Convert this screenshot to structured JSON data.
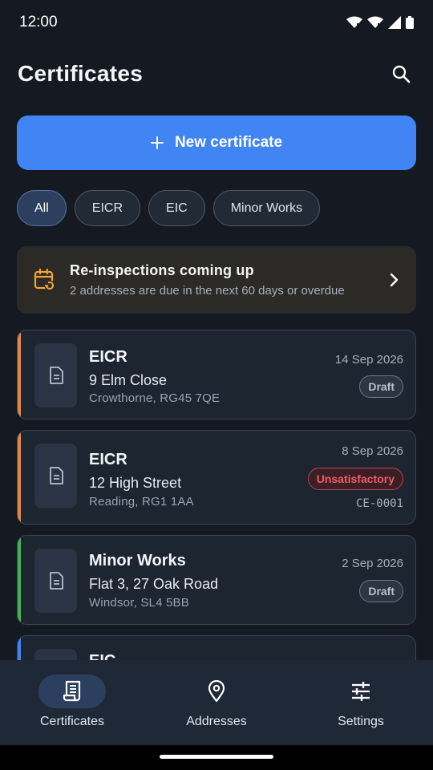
{
  "status_bar": {
    "time": "12:00"
  },
  "header": {
    "title": "Certificates"
  },
  "new_certificate": {
    "label": "New certificate"
  },
  "filters": [
    {
      "label": "All",
      "active": true
    },
    {
      "label": "EICR",
      "active": false
    },
    {
      "label": "EIC",
      "active": false
    },
    {
      "label": "Minor Works",
      "active": false
    }
  ],
  "reinspection": {
    "title": "Re-inspections coming up",
    "subtitle": "2 addresses are due in the next 60 days or overdue"
  },
  "certificates": [
    {
      "type": "EICR",
      "address": "9 Elm Close",
      "town": "Crowthorne, RG45 7QE",
      "date": "14 Sep 2026",
      "status": "Draft",
      "reference": ""
    },
    {
      "type": "EICR",
      "address": "12 High Street",
      "town": "Reading, RG1 1AA",
      "date": "8 Sep 2026",
      "status": "Unsatisfactory",
      "reference": "CE-0001"
    },
    {
      "type": "Minor Works",
      "address": "Flat 3, 27 Oak Road",
      "town": "Windsor, SL4 5BB",
      "date": "2 Sep 2026",
      "status": "Draft",
      "reference": ""
    },
    {
      "type": "EIC",
      "address": "",
      "town": "",
      "date": "",
      "status": "",
      "reference": ""
    }
  ],
  "bottom_nav": [
    {
      "label": "Certificates",
      "icon": "receipt-icon",
      "active": true
    },
    {
      "label": "Addresses",
      "icon": "location-pin-icon",
      "active": false
    },
    {
      "label": "Settings",
      "icon": "sliders-icon",
      "active": false
    }
  ],
  "colors": {
    "accent": "#4185f5",
    "eicr_accent": "#e08a45",
    "minor_works_accent": "#3fb65a",
    "eic_accent": "#4185f5",
    "unsatisfactory": "#ef5d63",
    "reinspect_icon": "#f0a531"
  }
}
